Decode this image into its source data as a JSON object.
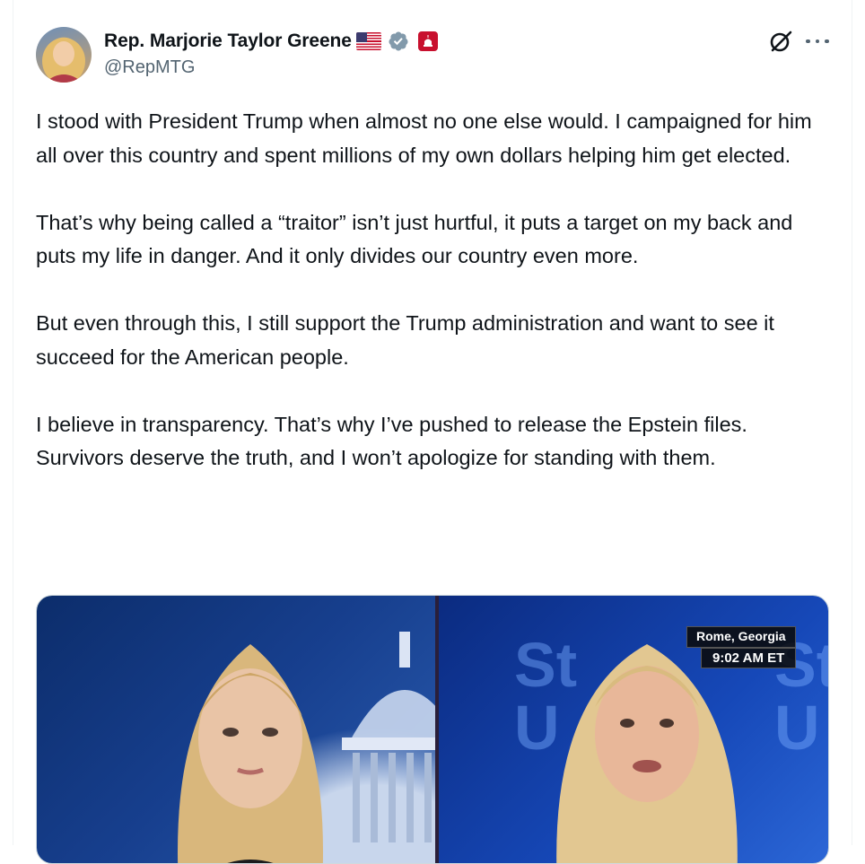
{
  "author": {
    "display_name": "Rep. Marjorie Taylor Greene",
    "handle": "@RepMTG",
    "badges": [
      "us-flag-emoji",
      "verified-gray-icon",
      "capitol-dome-badge"
    ]
  },
  "actions": {
    "icons": [
      "grok-icon",
      "more-options-icon"
    ]
  },
  "tweet": {
    "paragraphs": [
      "I stood with President Trump when almost no one else would. I campaigned for him all over this country and spent millions of my own dollars helping him get elected.",
      "That’s why being called a “traitor” isn’t just hurtful, it puts a target on my back and puts my life in danger. And it only divides our country even more.",
      "But even through this, I still support the Trump administration and want to see it succeed for the American people.",
      "I believe in transparency. That’s why I’ve pushed to release the Epstein files. Survivors deserve the truth, and I won’t apologize for standing with them."
    ]
  },
  "media": {
    "chyron_location": "Rome, Georgia",
    "chyron_time": "9:02 AM ET"
  },
  "colors": {
    "text_primary": "#0f1419",
    "text_secondary": "#536471",
    "verified_gray": "#829aab",
    "border": "#cfd9de"
  }
}
